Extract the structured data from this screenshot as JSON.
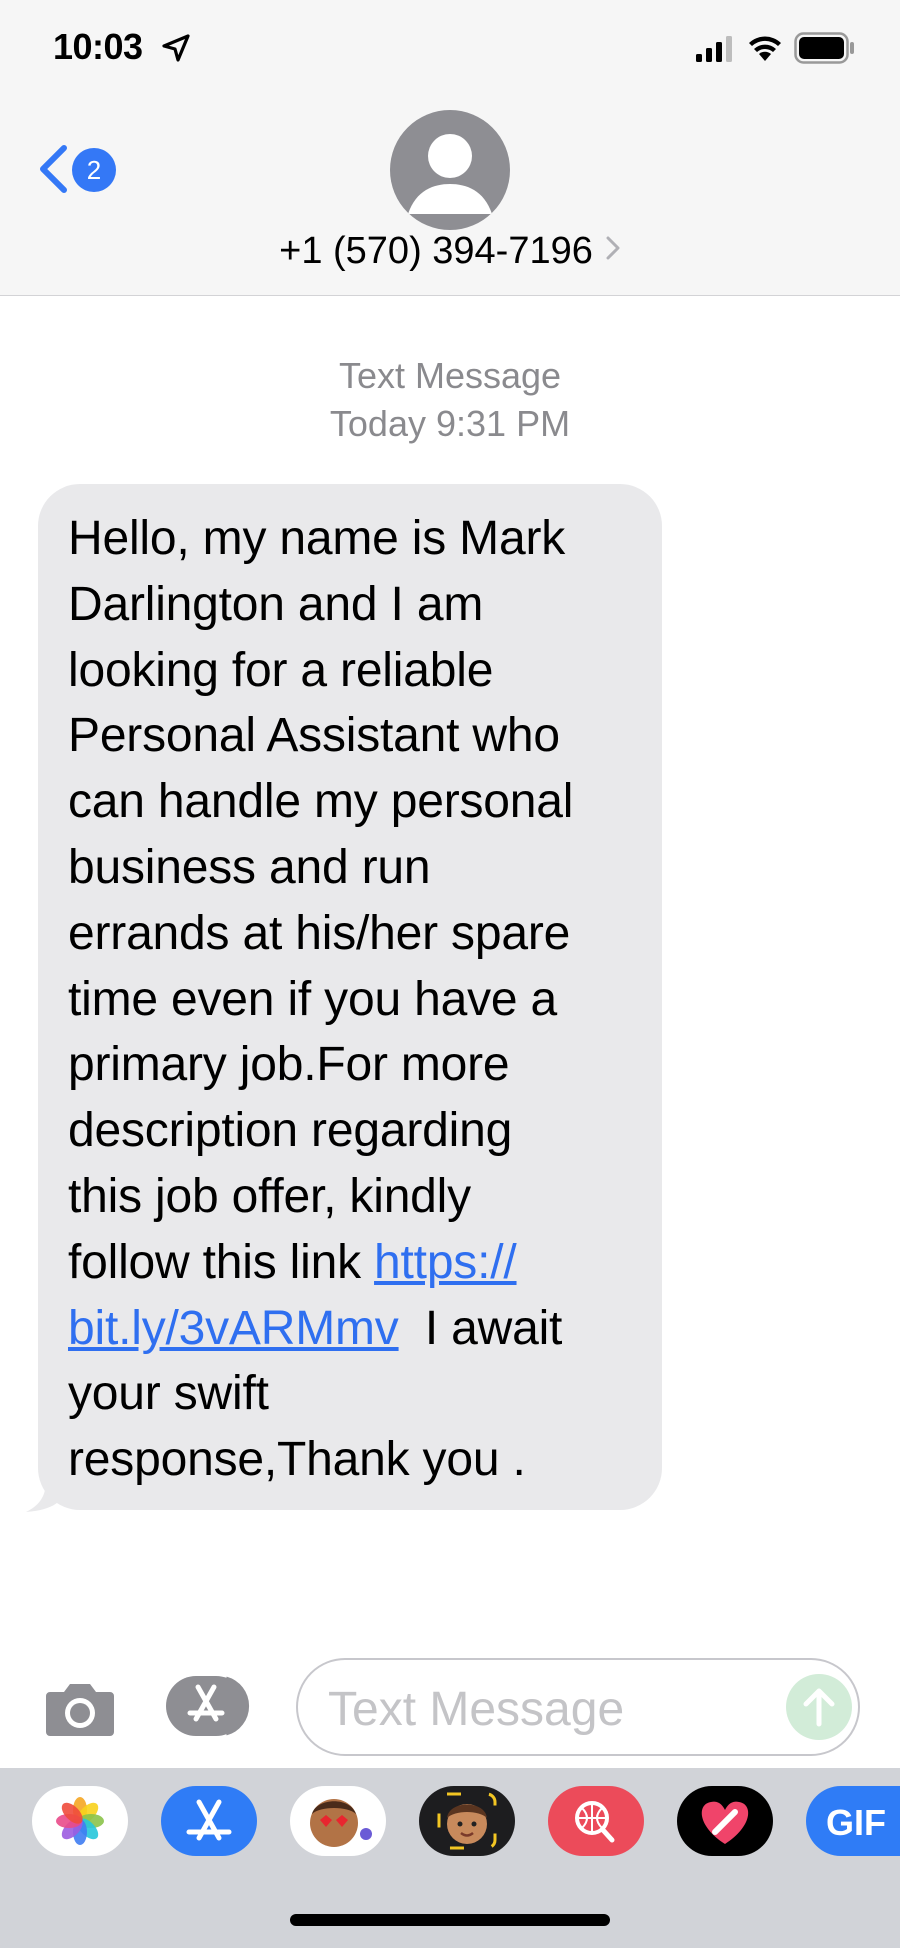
{
  "status_bar": {
    "time": "10:03"
  },
  "header": {
    "back_badge_count": "2",
    "contact": "+1 (570) 394-7196"
  },
  "thread": {
    "kind": "Text Message",
    "day": "Today",
    "time": "9:31 PM"
  },
  "message": {
    "lines": [
      "Hello, my name is Mark",
      "Darlington and I am",
      "looking for a reliable",
      "Personal Assistant who",
      "can handle my personal",
      "business and run",
      "errands at his/her spare",
      "time even if you have a",
      "primary job.For more",
      "description regarding",
      "this job offer, kindly"
    ],
    "line_12_text": "follow this link ",
    "link_part_1": "https://",
    "link_part_2": "bit.ly/3vARMmv",
    "line_13_rest": "  I await",
    "line_14": "your swift",
    "line_15": "response,Thank you ."
  },
  "composer": {
    "placeholder": "Text Message"
  },
  "drawer": {
    "apps": [
      "photos-app",
      "app-store-app",
      "animoji-app",
      "memoji-app",
      "image-search-app",
      "digital-touch-app",
      "gif-app"
    ],
    "gif_label": "GIF"
  },
  "colors": {
    "accent": "#3478f6",
    "bubble": "#e9e9eb",
    "link": "#2f6ff0",
    "meta": "#8a8a8e"
  }
}
